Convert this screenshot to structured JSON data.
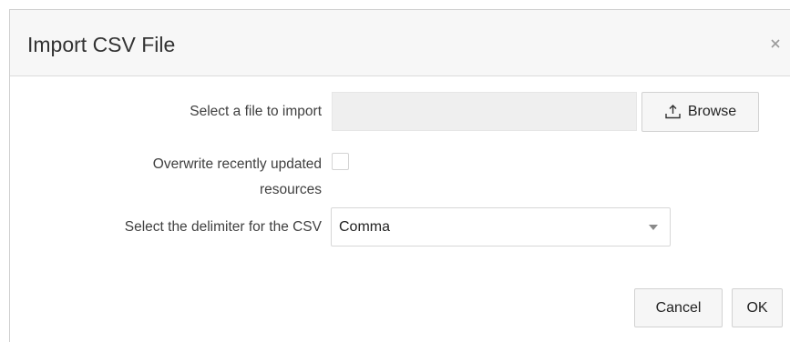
{
  "dialog": {
    "title": "Import CSV File",
    "close_label": "×"
  },
  "form": {
    "file_label": "Select a file to import",
    "file_value": "",
    "browse_label": "Browse",
    "browse_icon": "upload-icon",
    "overwrite_label_line1": "Overwrite recently updated",
    "overwrite_label_line2": "resources",
    "overwrite_checked": false,
    "delimiter_label": "Select the delimiter for the CSV",
    "delimiter_value": "Comma"
  },
  "footer": {
    "cancel_label": "Cancel",
    "ok_label": "OK"
  }
}
